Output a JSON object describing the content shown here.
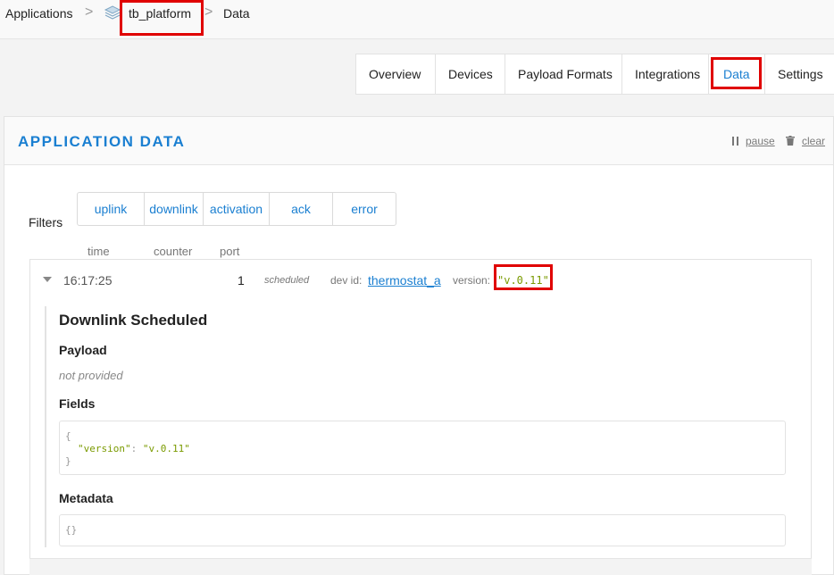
{
  "breadcrumb": {
    "applications": "Applications",
    "app_id": "tb_platform",
    "current": "Data",
    "separator": ">"
  },
  "tabs": [
    "Overview",
    "Devices",
    "Payload Formats",
    "Integrations",
    "Data",
    "Settings"
  ],
  "active_tab": "Data",
  "panel": {
    "title": "APPLICATION DATA",
    "pause": "pause",
    "clear": "clear"
  },
  "filters": {
    "label": "Filters",
    "items": [
      "uplink",
      "downlink",
      "activation",
      "ack",
      "error"
    ]
  },
  "columns": {
    "time": "time",
    "counter": "counter",
    "port": "port"
  },
  "entry": {
    "time": "16:17:25",
    "port": "1",
    "type": "scheduled",
    "dev_id_label": "dev id:",
    "dev_id": "thermostat_a",
    "version_label": "version:",
    "version": "\"v.0.11\""
  },
  "detail": {
    "title": "Downlink Scheduled",
    "payload_heading": "Payload",
    "payload_value": "not provided",
    "fields_heading": "Fields",
    "fields_open": "{",
    "fields_key": "\"version\"",
    "fields_colon": ":",
    "fields_value": "\"v.0.11\"",
    "fields_close": "}",
    "metadata_heading": "Metadata",
    "metadata_value": "{}"
  },
  "colors": {
    "accent": "#1a7fd1",
    "highlight": "#e00000",
    "json_value": "#7a9a00"
  },
  "icons": [
    "chevron-right-icon",
    "stack-icon",
    "pause-icon",
    "trash-icon",
    "caret-down-icon"
  ]
}
